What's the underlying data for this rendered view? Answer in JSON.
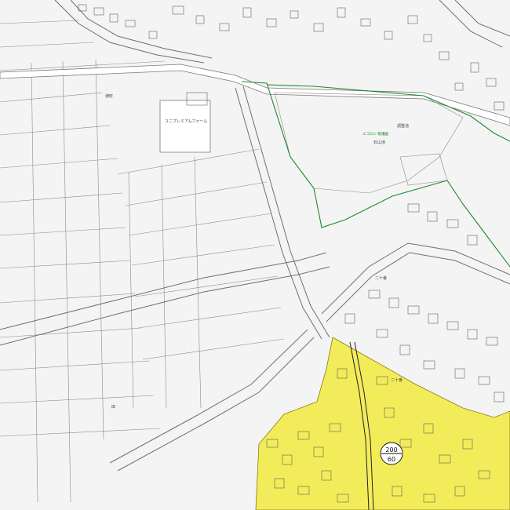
{
  "map": {
    "zone_badge": {
      "upper": "200",
      "lower": "60"
    },
    "facility": {
      "name": "エコロジ 看護園",
      "sub": "石山池"
    },
    "labels": {
      "school": "ユニプレミアムファーム",
      "water": "調整池",
      "area_north": "通町",
      "block_a": "二十番",
      "block_b": "二十番",
      "field": "田"
    },
    "colors": {
      "zone_fill": "#f2ec5a",
      "boundary": "#1f8a2e",
      "parcel_line": "#8a8a8a"
    }
  }
}
